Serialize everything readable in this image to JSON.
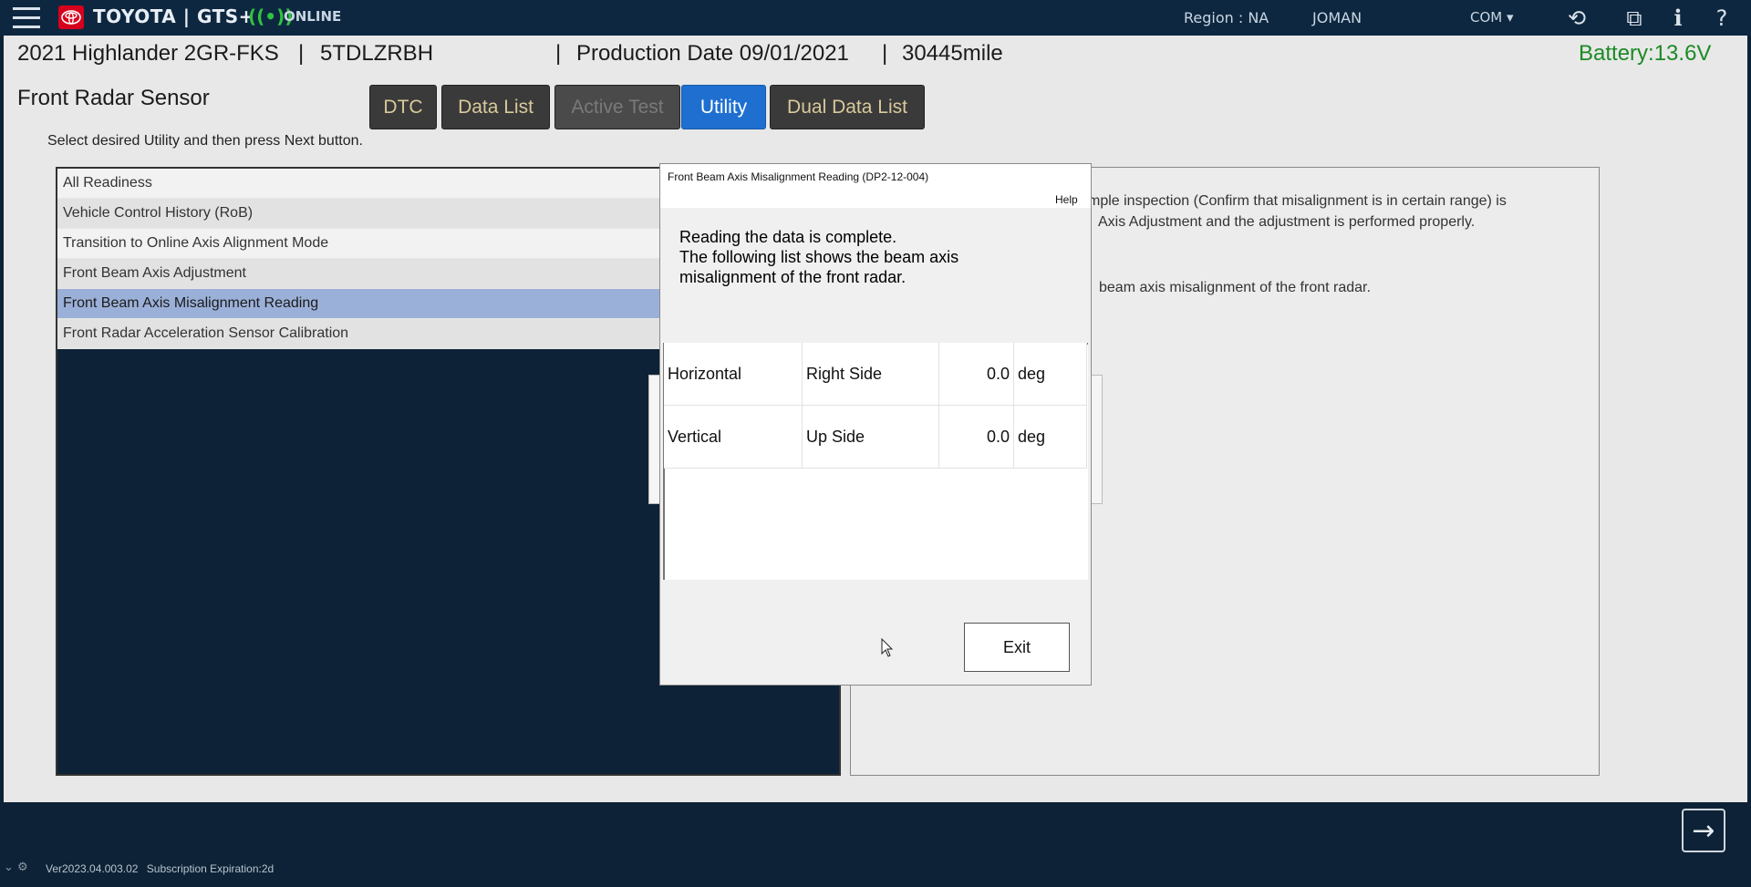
{
  "topbar": {
    "brand": "TOYOTA | GTS+",
    "connection_status": "ONLINE",
    "region": "Region : NA",
    "user": "JOMAN",
    "account": "COM ▾",
    "icons": [
      "menu-icon",
      "toyota-logo",
      "wireless-icon",
      "history-icon",
      "external-link-icon",
      "info-icon",
      "help-icon"
    ]
  },
  "vehicle": {
    "model": "2021 Highlander 2GR-FKS",
    "vin": "5TDLZRBH",
    "production_date": "Production Date 09/01/2021",
    "mileage": "30445mile",
    "separator": "|",
    "battery": "Battery:13.6V"
  },
  "system": {
    "title": "Front Radar Sensor"
  },
  "tabs": [
    {
      "label": "DTC",
      "state": "normal"
    },
    {
      "label": "Data List",
      "state": "normal"
    },
    {
      "label": "Active Test",
      "state": "disabled"
    },
    {
      "label": "Utility",
      "state": "active"
    },
    {
      "label": "Dual Data List",
      "state": "normal"
    }
  ],
  "instruction": "Select desired Utility and then press Next button.",
  "utility_list": [
    "All Readiness",
    "Vehicle Control History (RoB)",
    "Transition to Online Axis Alignment Mode",
    "Front Beam Axis Adjustment",
    "Front Beam Axis Misalignment Reading",
    "Front Radar Acceleration Sensor Calibration"
  ],
  "selected_utility_index": 4,
  "description": {
    "line1": "mple inspection (Confirm that misalignment is in certain range) is",
    "line2": "Axis Adjustment and the adjustment is performed properly.",
    "line3": "beam axis misalignment of the front radar."
  },
  "dialog": {
    "title": "Front Beam Axis Misalignment Reading (DP2-12-004)",
    "help": "Help",
    "message": [
      "Reading the data is complete.",
      "The following list shows the beam axis",
      "misalignment of the front radar."
    ],
    "rows": [
      {
        "axis": "Horizontal",
        "side": "Right Side",
        "value": "0.0",
        "unit": "deg"
      },
      {
        "axis": "Vertical",
        "side": "Up Side",
        "value": "0.0",
        "unit": "deg"
      }
    ],
    "exit_label": "Exit"
  },
  "footer": {
    "version": "Ver2023.04.003.02",
    "subscription": "Subscription Expiration:2d",
    "next_icon": "arrow-right-icon"
  },
  "colors": {
    "topbar_bg": "#0e2740",
    "active_tab": "#1e6fd0",
    "tab_text": "#d9c99a",
    "battery": "#1c8a24",
    "selected_row": "#9bb0d8"
  }
}
